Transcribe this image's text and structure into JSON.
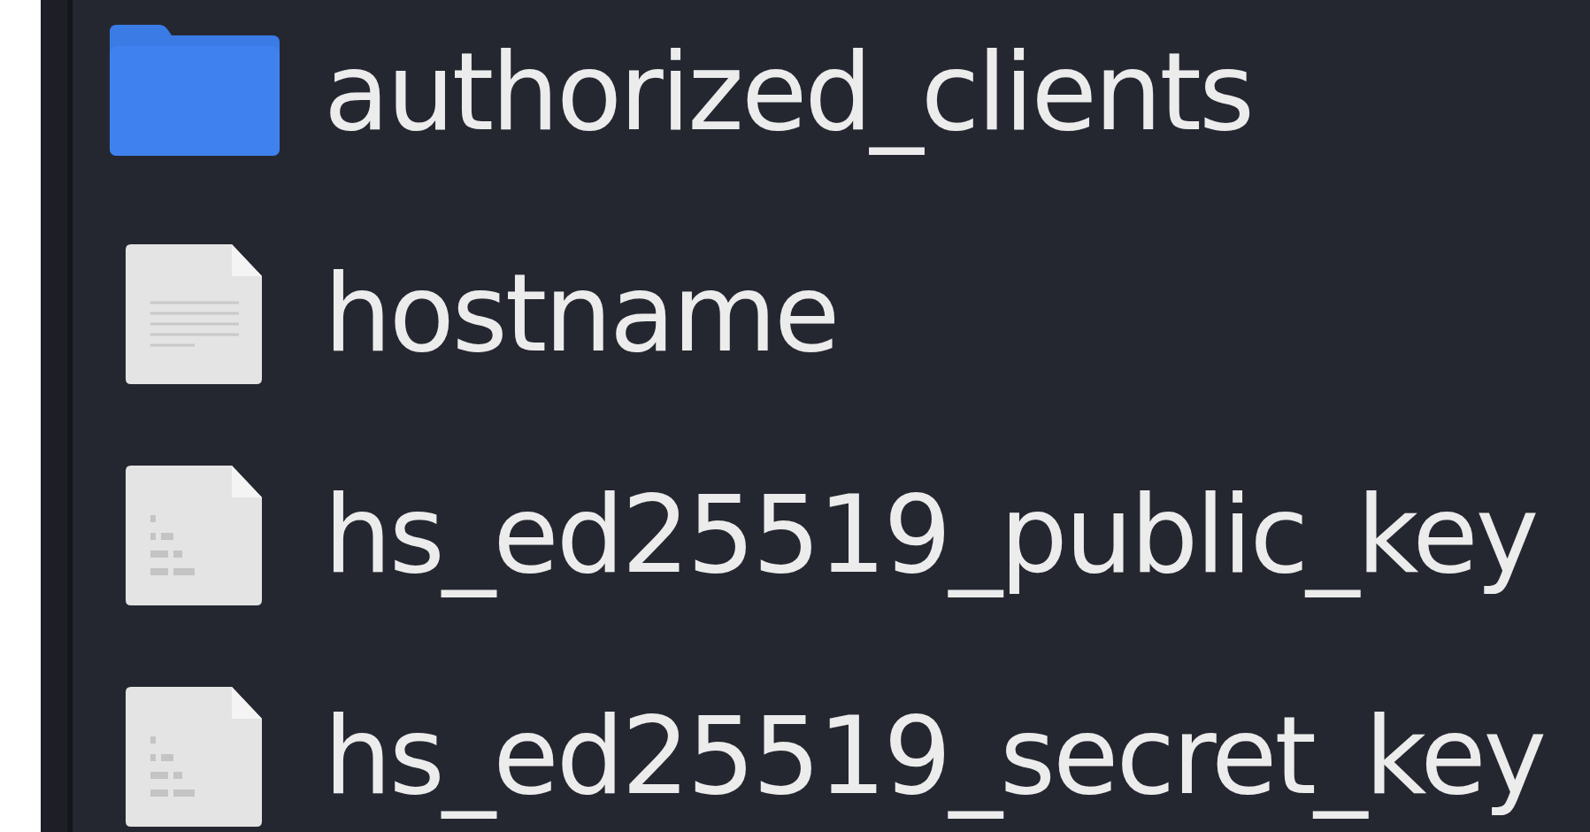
{
  "files": [
    {
      "name": "authorized_clients",
      "kind": "folder"
    },
    {
      "name": "hostname",
      "kind": "text"
    },
    {
      "name": "hs_ed25519_public_key",
      "kind": "binary"
    },
    {
      "name": "hs_ed25519_secret_key",
      "kind": "binary"
    }
  ]
}
